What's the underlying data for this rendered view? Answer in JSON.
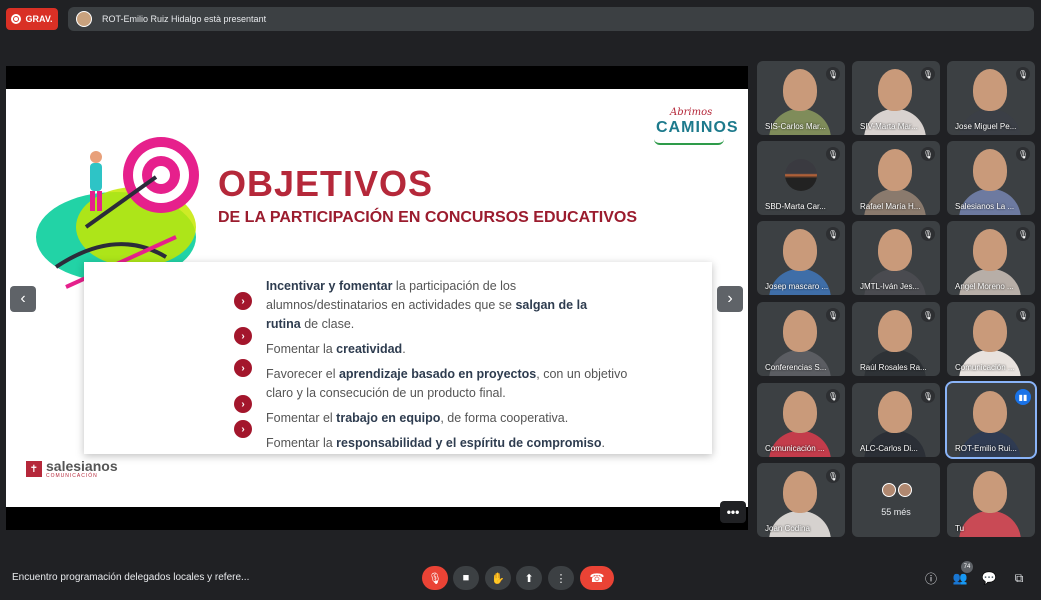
{
  "top": {
    "rec_label": "GRAV.",
    "presenting_text": "ROT-Emilio Ruiz Hidalgo està presentant"
  },
  "slide": {
    "logo_script": "Abrimos",
    "logo_caps": "CAMINOS",
    "title": "OBJETIVOS",
    "subtitle": "DE LA PARTICIPACIÓN EN CONCURSOS EDUCATIVOS",
    "lines": [
      {
        "pre": "",
        "b1": "Incentivar y fomentar",
        "mid": " la participación de los",
        "b2": "",
        "post": ""
      },
      {
        "pre": "alumnos/destinatarios en actividades que se ",
        "b1": "salgan de la",
        "mid": "",
        "b2": "",
        "post": ""
      },
      {
        "pre": "",
        "b1": "rutina",
        "mid": " de clase.",
        "b2": "",
        "post": ""
      },
      {
        "pre": "Fomentar la ",
        "b1": "creatividad",
        "mid": ".",
        "b2": "",
        "post": ""
      },
      {
        "pre": "Favorecer el ",
        "b1": "aprendizaje basado en proyectos",
        "mid": ", con un objetivo",
        "b2": "",
        "post": ""
      },
      {
        "pre": "claro y la consecución de un producto final.",
        "b1": "",
        "mid": "",
        "b2": "",
        "post": ""
      },
      {
        "pre": "Fomentar el ",
        "b1": "trabajo en equipo",
        "mid": ", de forma cooperativa.",
        "b2": "",
        "post": ""
      },
      {
        "pre": "Fomentar la ",
        "b1": "responsabilidad y el espíritu de compromiso",
        "mid": ".",
        "b2": "",
        "post": ""
      }
    ],
    "bullet_glyph": "›",
    "brand_name": "salesianos",
    "brand_sub": "COMUNICACIÓN",
    "brand_mark": "✝"
  },
  "participants": [
    {
      "name": "SIS-Carlos Mar...",
      "body": "#7f8c5a"
    },
    {
      "name": "SIV-Marta Mar...",
      "body": "#d8d2cf"
    },
    {
      "name": "Jose Miguel Pe...",
      "body": "#3b3f46"
    },
    {
      "name": "SBD-Marta Car...",
      "body": ""
    },
    {
      "name": "Rafael María H...",
      "body": "#8a7a6d"
    },
    {
      "name": "Salesianos La ...",
      "body": "#6d7aa0"
    },
    {
      "name": "Josep mascaro ...",
      "body": "#3f6ea8"
    },
    {
      "name": "JMTL-Iván Jes...",
      "body": "#4a4b50"
    },
    {
      "name": "Angel Moreno ...",
      "body": "#b7aea7"
    },
    {
      "name": "Conferencias S...",
      "body": "#5b5d62"
    },
    {
      "name": "Raúl Rosales Ra...",
      "body": "#2e3236"
    },
    {
      "name": "Comunicación ...",
      "body": "#e8e2de"
    },
    {
      "name": "Comunicación ...",
      "body": "#c33c4b"
    },
    {
      "name": "ALC-Carlos Di...",
      "body": "#2b2f36"
    },
    {
      "name": "ROT-Emilio Rui...",
      "body": "#2f3b52"
    },
    {
      "name": "Joan Codina",
      "body": "#d6d2cf"
    },
    {
      "name": "",
      "body": ""
    },
    {
      "name": "Tu",
      "body": "#c94a55"
    }
  ],
  "more_label": "55 més",
  "bottom": {
    "meeting_title": "Encuentro programación delegados locales y refere...",
    "people_count": "74"
  }
}
